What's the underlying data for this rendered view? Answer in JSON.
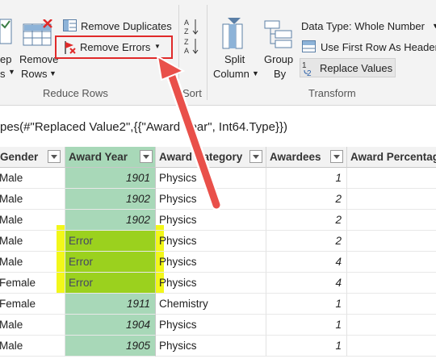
{
  "ribbon": {
    "left_partial_top": "ep",
    "left_partial_bottom": "s",
    "remove_rows": [
      "Remove",
      "Rows"
    ],
    "remove_duplicates": "Remove Duplicates",
    "remove_errors": "Remove Errors",
    "reduce_rows_group": "Reduce Rows",
    "sort_group": "Sort",
    "split_column": [
      "Split",
      "Column"
    ],
    "group_by": [
      "Group",
      "By"
    ],
    "data_type": "Data Type: Whole Number",
    "use_first_row": "Use First Row As Headers",
    "replace_values": "Replace Values",
    "transform_group": "Transform",
    "accent_red": "#e02a2a"
  },
  "formula": "pes(#\"Replaced Value2\",{{\"Award Year\", Int64.Type}})",
  "table": {
    "columns": [
      "Gender",
      "Award Year",
      "Award Category",
      "Awardees",
      "Award Percentage"
    ],
    "rows": [
      [
        "Male",
        "1901",
        "Physics",
        "1"
      ],
      [
        "Male",
        "1902",
        "Physics",
        "2"
      ],
      [
        "Male",
        "1902",
        "Physics",
        "2"
      ],
      [
        "Male",
        "Error",
        "Physics",
        "2"
      ],
      [
        "Male",
        "Error",
        "Physics",
        "4"
      ],
      [
        "Female",
        "Error",
        "Physics",
        "4"
      ],
      [
        "Female",
        "1911",
        "Chemistry",
        "1"
      ],
      [
        "Male",
        "1904",
        "Physics",
        "1"
      ],
      [
        "Male",
        "1905",
        "Physics",
        "1"
      ]
    ]
  }
}
